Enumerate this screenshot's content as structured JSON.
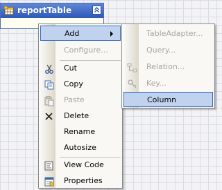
{
  "table": {
    "title": "reportTable",
    "icon": "table-icon",
    "collapse_icon": "collapse-up-icon",
    "header_color": "#2d58b8"
  },
  "context_menu": {
    "highlight_color": "#c1d2ee",
    "items": [
      {
        "label": "Add",
        "icon": "",
        "enabled": true,
        "submenu": true,
        "highlighted": true
      },
      {
        "label": "Configure...",
        "icon": "",
        "enabled": false
      },
      {
        "label": "Cut",
        "icon": "scissors-icon",
        "enabled": true
      },
      {
        "label": "Copy",
        "icon": "copy-icon",
        "enabled": true
      },
      {
        "label": "Paste",
        "icon": "paste-icon",
        "enabled": false
      },
      {
        "label": "Delete",
        "icon": "delete-x-icon",
        "enabled": true
      },
      {
        "label": "Rename",
        "icon": "",
        "enabled": true
      },
      {
        "label": "Autosize",
        "icon": "",
        "enabled": true
      },
      {
        "label": "View Code",
        "icon": "view-code-icon",
        "enabled": true
      },
      {
        "label": "Properties",
        "icon": "properties-icon",
        "enabled": true
      }
    ]
  },
  "add_submenu": {
    "items": [
      {
        "label": "TableAdapter...",
        "icon": "",
        "enabled": false
      },
      {
        "label": "Query...",
        "icon": "",
        "enabled": false
      },
      {
        "label": "Relation...",
        "icon": "relation-icon",
        "enabled": false
      },
      {
        "label": "Key...",
        "icon": "key-icon",
        "enabled": false
      },
      {
        "label": "Column",
        "icon": "",
        "enabled": true,
        "highlighted": true
      }
    ]
  }
}
